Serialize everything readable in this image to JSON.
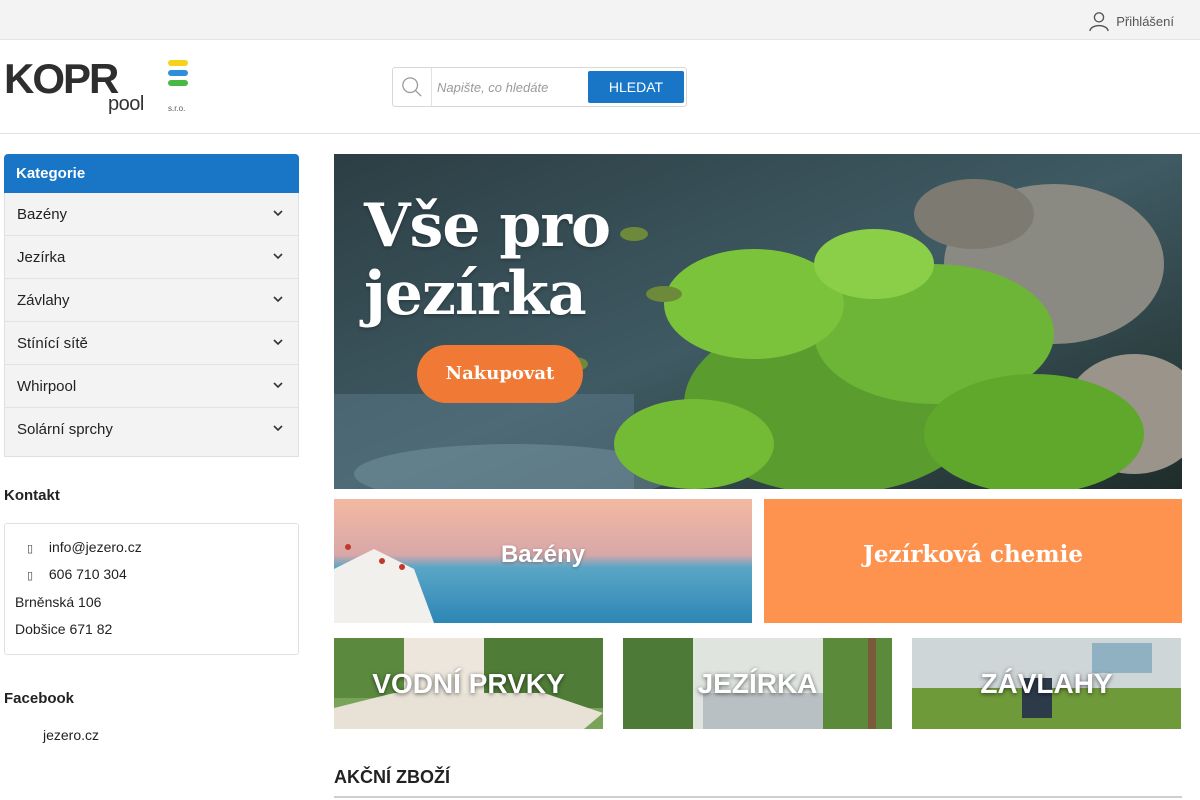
{
  "topbar": {
    "login_label": "Přihlášení"
  },
  "logo": {
    "main": "KOPR",
    "sub": "pool",
    "sro": "s.r.o."
  },
  "search": {
    "placeholder": "Napište, co hledáte",
    "button_label": "HLEDAT"
  },
  "sidebar": {
    "header": "Kategorie",
    "items": [
      {
        "label": "Bazény"
      },
      {
        "label": "Jezírka"
      },
      {
        "label": "Závlahy"
      },
      {
        "label": "Stínící sítě"
      },
      {
        "label": "Whirpool"
      },
      {
        "label": "Solární sprchy"
      }
    ]
  },
  "contact": {
    "title": "Kontakt",
    "email": "info@jezero.cz",
    "phone": "606 710 304",
    "street": "Brněnská 106",
    "city": "Dobšice 671 82"
  },
  "facebook": {
    "title": "Facebook",
    "link": "jezero.cz"
  },
  "hero": {
    "title": "Vše pro\njezírka",
    "button": "Nakupovat"
  },
  "banners": {
    "bazeny": "Bazény",
    "chemie": "Jezírková chemie",
    "vodni": "VODNÍ PRVKY",
    "jezirka": "JEZÍRKA",
    "zavlahy": "ZÁVLAHY"
  },
  "section": {
    "akcni": "AKČNÍ ZBOŽÍ"
  },
  "colors": {
    "accent": "#1976c7",
    "orange": "#f07a35",
    "chemie_bg": "#fd934f"
  }
}
